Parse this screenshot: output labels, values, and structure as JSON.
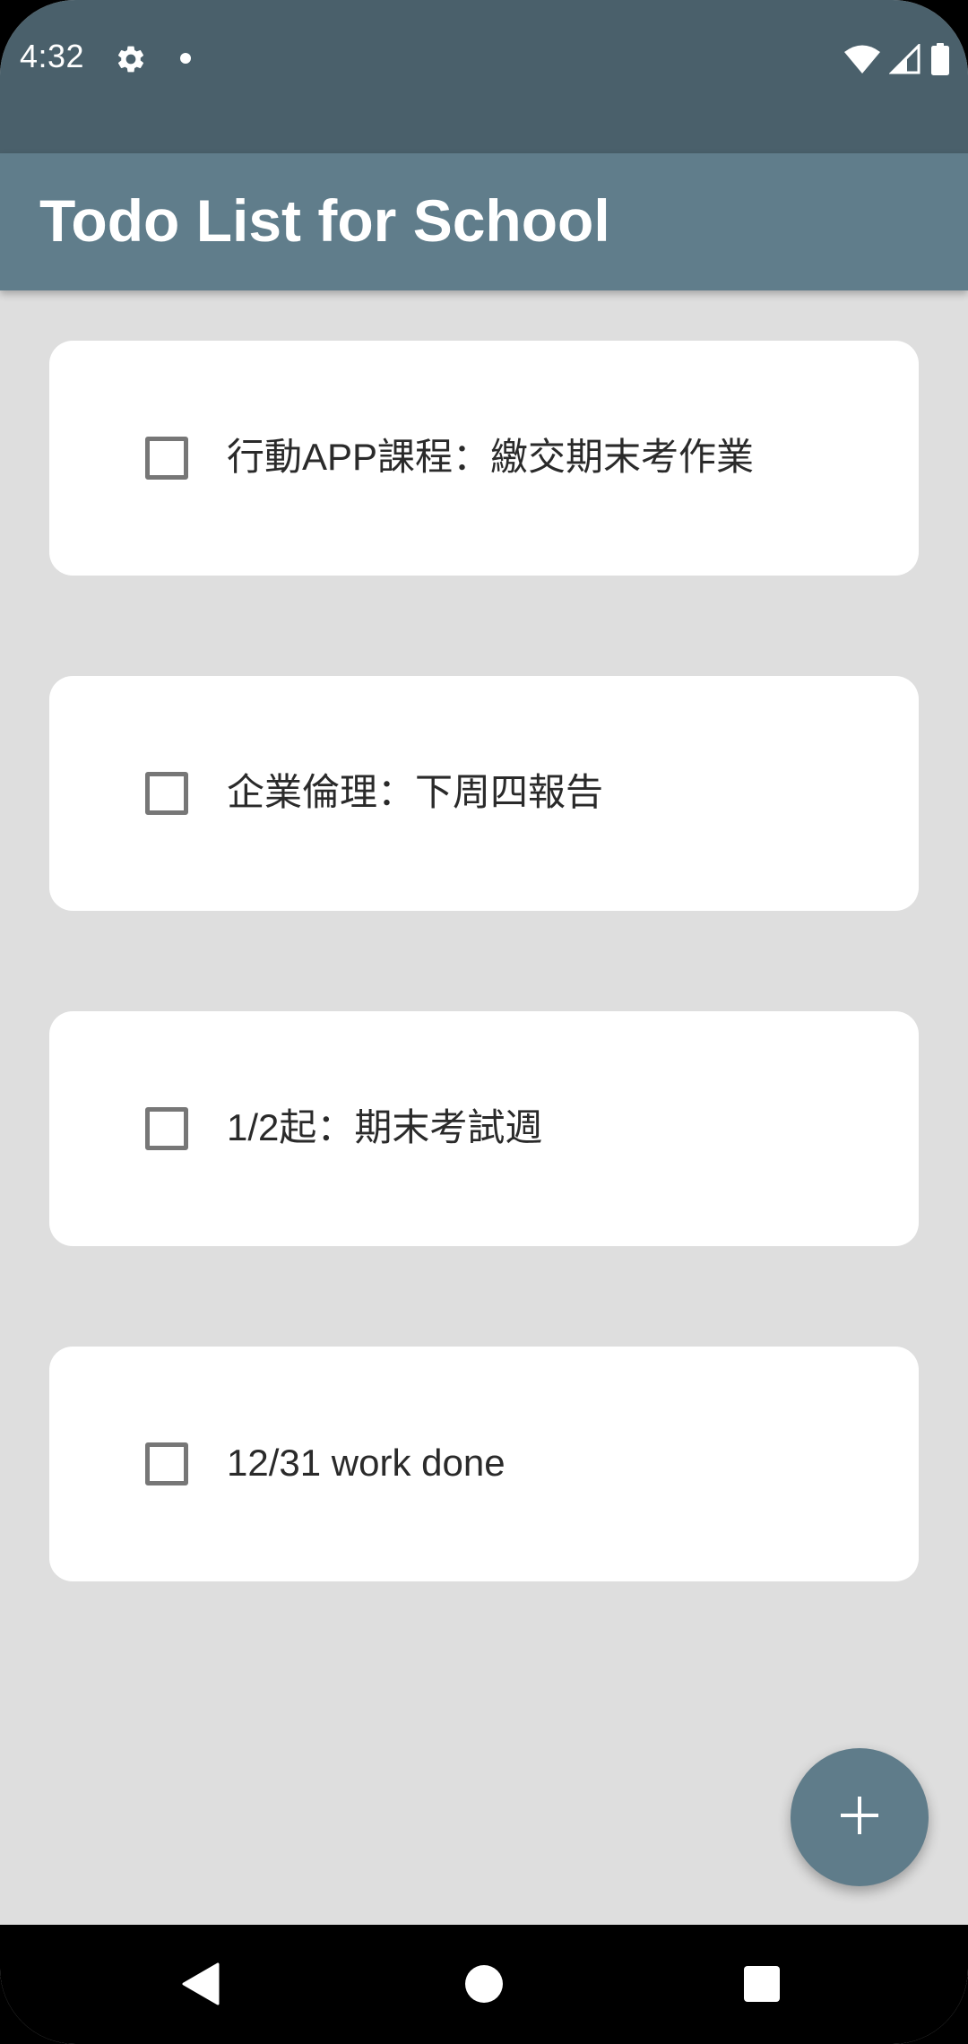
{
  "status_bar": {
    "time": "4:32",
    "icons": [
      "gear-icon",
      "notification-dot-icon",
      "wifi-icon",
      "signal-icon",
      "battery-icon"
    ]
  },
  "app_bar": {
    "title": "Todo List for School"
  },
  "todos": [
    {
      "text": "行動APP課程：繳交期末考作業",
      "checked": false
    },
    {
      "text": "企業倫理：下周四報告",
      "checked": false
    },
    {
      "text": "1/2起：期末考試週",
      "checked": false
    },
    {
      "text": "12/31 work done",
      "checked": false
    }
  ],
  "fab": {
    "icon": "plus-icon"
  },
  "nav_bar": {
    "icons": [
      "back-icon",
      "home-icon",
      "recents-icon"
    ]
  },
  "colors": {
    "status_bar": "#4a606b",
    "app_bar": "#607d8b",
    "background": "#dedede",
    "card": "#ffffff",
    "fab": "#5f7c8a",
    "checkbox_border": "#777777"
  }
}
